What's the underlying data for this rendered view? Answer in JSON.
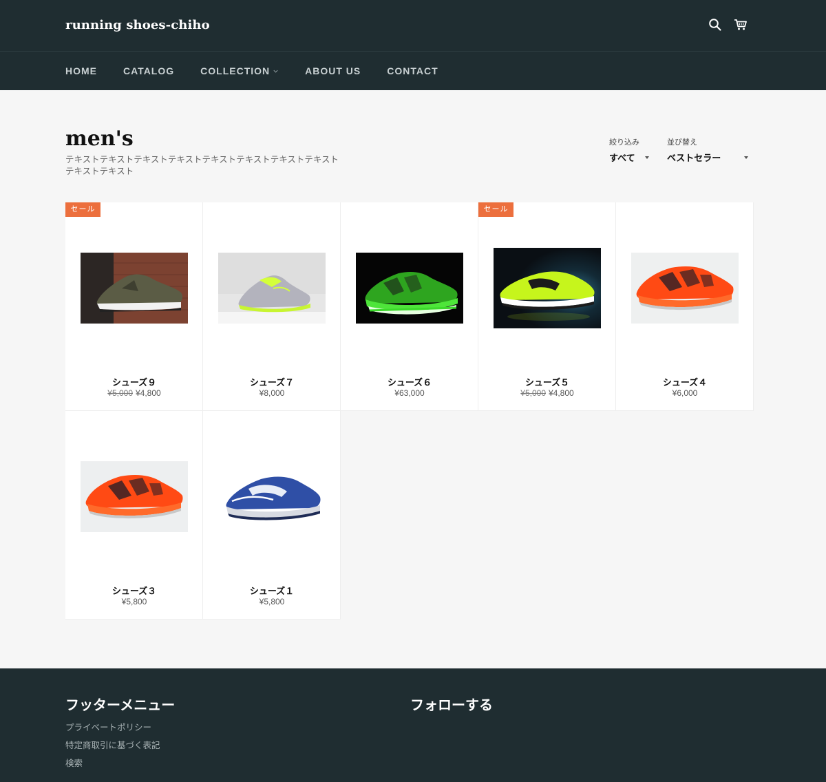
{
  "header": {
    "logo": "running shoes-chiho",
    "icons": {
      "search": "search-icon",
      "cart": "cart-icon"
    }
  },
  "nav": [
    {
      "label": "HOME"
    },
    {
      "label": "CATALOG"
    },
    {
      "label": "COLLECTION",
      "has_dropdown": true
    },
    {
      "label": "ABOUT US"
    },
    {
      "label": "CONTACT"
    }
  ],
  "collection": {
    "title": "men's",
    "description": "テキストテキストテキストテキストテキストテキストテキストテキストテキストテキスト"
  },
  "filters": {
    "filter_label": "絞り込み",
    "filter_value": "すべて",
    "sort_label": "並び替え",
    "sort_value": "ベストセラー"
  },
  "products": [
    {
      "name": "シューズ９",
      "compare_price": "¥5,000",
      "price": "¥4,800",
      "sale": true,
      "badge": "セール"
    },
    {
      "name": "シューズ７",
      "compare_price": "",
      "price": "¥8,000",
      "sale": false,
      "badge": ""
    },
    {
      "name": "シューズ６",
      "compare_price": "",
      "price": "¥63,000",
      "sale": false,
      "badge": ""
    },
    {
      "name": "シューズ５",
      "compare_price": "¥5,000",
      "price": "¥4,800",
      "sale": true,
      "badge": "セール"
    },
    {
      "name": "シューズ４",
      "compare_price": "",
      "price": "¥6,000",
      "sale": false,
      "badge": ""
    },
    {
      "name": "シューズ３",
      "compare_price": "",
      "price": "¥5,800",
      "sale": false,
      "badge": ""
    },
    {
      "name": "シューズ１",
      "compare_price": "",
      "price": "¥5,800",
      "sale": false,
      "badge": ""
    }
  ],
  "footer": {
    "menu_heading": "フッターメニュー",
    "follow_heading": "フォローする",
    "links": [
      "プライベートポリシー",
      "特定商取引に基づく表記",
      "検索"
    ]
  },
  "colors": {
    "header_bg": "#1f2d31",
    "sale_badge": "#ec6f3d",
    "page_bg": "#f6f6f6"
  }
}
